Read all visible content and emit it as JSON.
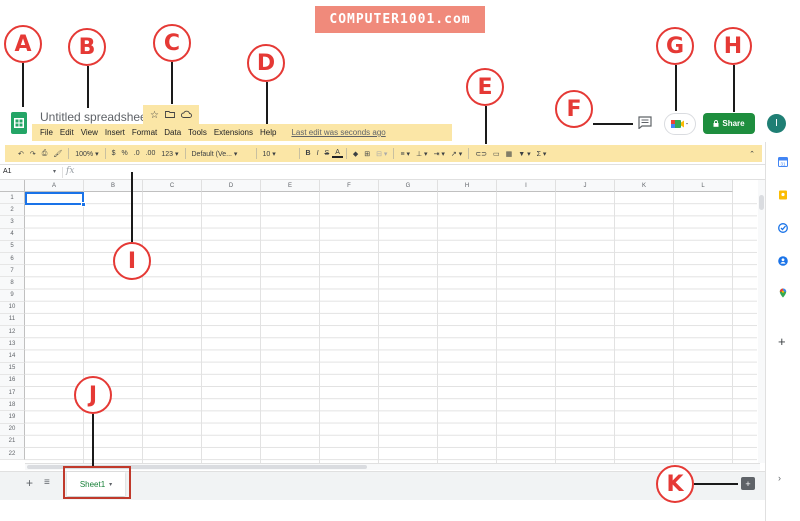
{
  "banner": "COMPUTER1001.com",
  "callouts": [
    "A",
    "B",
    "C",
    "D",
    "E",
    "F",
    "G",
    "H",
    "I",
    "J",
    "K"
  ],
  "header": {
    "doc_title": "Untitled spreadsheet",
    "menu": [
      "File",
      "Edit",
      "View",
      "Insert",
      "Format",
      "Data",
      "Tools",
      "Extensions",
      "Help"
    ],
    "last_edit": "Last edit was seconds ago",
    "share_label": "Share",
    "avatar_letter": "I"
  },
  "toolbar": {
    "zoom": "100%",
    "currency": "$",
    "percent": "%",
    "decrease_decimal": ".0",
    "increase_decimal": ".00",
    "more_formats": "123",
    "font": "Default (Ve...",
    "font_size": "10"
  },
  "formula_bar": {
    "cell_ref": "A1",
    "fx": "fx"
  },
  "grid": {
    "columns": [
      "A",
      "B",
      "C",
      "D",
      "E",
      "F",
      "G",
      "H",
      "I",
      "J",
      "K",
      "L"
    ],
    "rows": [
      "1",
      "2",
      "3",
      "4",
      "5",
      "6",
      "7",
      "8",
      "9",
      "10",
      "11",
      "12",
      "13",
      "14",
      "15",
      "16",
      "17",
      "18",
      "19",
      "20",
      "21",
      "22"
    ]
  },
  "bottom": {
    "sheet_tab": "Sheet1"
  },
  "colors": {
    "highlight": "#fbe6a6",
    "callout": "#e53935",
    "share": "#1e8e3e",
    "sheet_tab_text": "#188038",
    "brand_green": "#23a566"
  },
  "icons": [
    "sheets-logo-icon",
    "star-icon",
    "folder-move-icon",
    "cloud-status-icon",
    "comment-icon",
    "meet-icon",
    "lock-icon",
    "explore-icon",
    "calendar-icon",
    "keep-icon",
    "tasks-icon",
    "contacts-icon",
    "maps-icon",
    "add-icon",
    "chevron-right-icon"
  ]
}
